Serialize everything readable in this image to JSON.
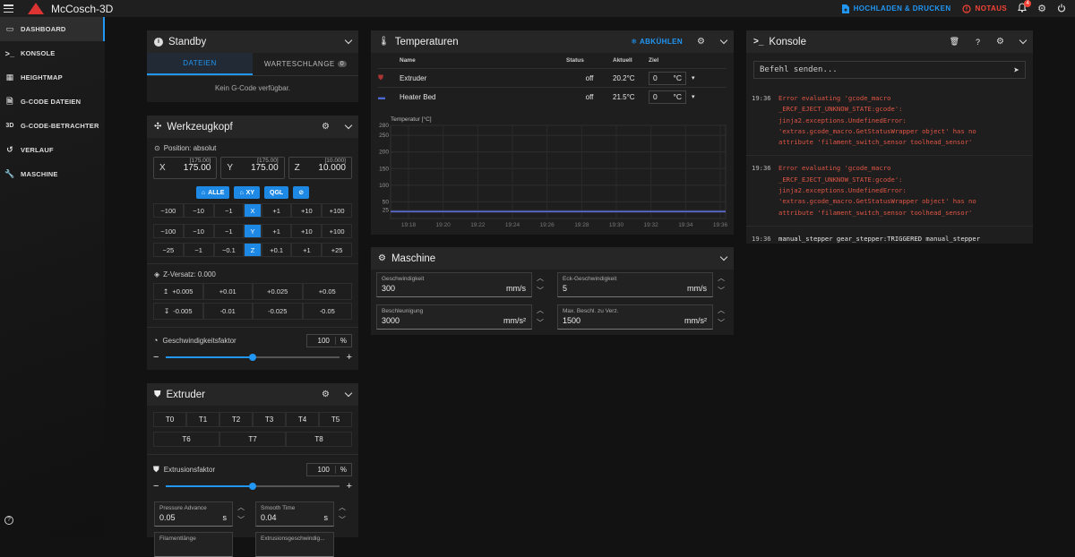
{
  "app": {
    "title": "McCosch-3D"
  },
  "topbar": {
    "upload_label": "HOCHLADEN & DRUCKEN",
    "estop_label": "NOTAUS",
    "notif_count": "4"
  },
  "nav": [
    {
      "label": "DASHBOARD",
      "icon": "dashboard-icon",
      "active": true
    },
    {
      "label": "KONSOLE",
      "icon": "console-icon"
    },
    {
      "label": "HEIGHTMAP",
      "icon": "grid-icon"
    },
    {
      "label": "G-CODE DATEIEN",
      "icon": "file-icon"
    },
    {
      "label": "G-CODE-BETRACHTER",
      "icon": "3d-icon"
    },
    {
      "label": "VERLAUF",
      "icon": "history-icon"
    },
    {
      "label": "MASCHINE",
      "icon": "wrench-icon"
    }
  ],
  "standby": {
    "title": "Standby",
    "tab_files": "DATEIEN",
    "tab_queue": "WARTESCHLANGE",
    "queue_count": "0",
    "empty": "Kein G-Code verfügbar."
  },
  "toolhead": {
    "title": "Werkzeugkopf",
    "position_label": "Position: absolut",
    "x": {
      "axis": "X",
      "value": "175.00",
      "max": "[175.00]"
    },
    "y": {
      "axis": "Y",
      "value": "175.00",
      "max": "[175.00]"
    },
    "z": {
      "axis": "Z",
      "value": "10.000",
      "max": "[10.000]"
    },
    "home_all": "ALLE",
    "home_xy": "XY",
    "qgl": "QGL",
    "jog_x": [
      "−100",
      "−10",
      "−1",
      "X",
      "+1",
      "+10",
      "+100"
    ],
    "jog_y": [
      "−100",
      "−10",
      "−1",
      "Y",
      "+1",
      "+10",
      "+100"
    ],
    "jog_z": [
      "−25",
      "−1",
      "−0.1",
      "Z",
      "+0.1",
      "+1",
      "+25"
    ],
    "zoffset_label": "Z-Versatz: 0.000",
    "zoff_up": [
      "+0.005",
      "+0.01",
      "+0.025",
      "+0.05"
    ],
    "zoff_down": [
      "-0.005",
      "-0.01",
      "-0.025",
      "-0.05"
    ],
    "speed_label": "Geschwindigkeitsfaktor",
    "speed_value": "100",
    "speed_unit": "%",
    "speed_fraction": 0.5
  },
  "extruder": {
    "title": "Extruder",
    "tools_row1": [
      "T0",
      "T1",
      "T2",
      "T3",
      "T4",
      "T5"
    ],
    "tools_row2": [
      "T6",
      "T7",
      "T8"
    ],
    "factor_label": "Extrusionsfaktor",
    "factor_value": "100",
    "factor_unit": "%",
    "factor_fraction": 0.5,
    "pa_label": "Pressure Advance",
    "pa_value": "0.05",
    "pa_unit": "s",
    "st_label": "Smooth Time",
    "st_value": "0.04",
    "st_unit": "s",
    "len_label": "Filamentlänge",
    "speed_label": "Extrusionsgeschwindig..."
  },
  "temps": {
    "title": "Temperaturen",
    "cooldown": "ABKÜHLEN",
    "headers": {
      "name": "Name",
      "status": "Status",
      "actual": "Aktuell",
      "target": "Ziel"
    },
    "rows": [
      {
        "name": "Extruder",
        "status": "off",
        "actual": "20.2°C",
        "target": "0",
        "unit": "°C"
      },
      {
        "name": "Heater Bed",
        "status": "off",
        "actual": "21.5°C",
        "target": "0",
        "unit": "°C"
      }
    ],
    "chart_ylabel": "Temperatur [°C]"
  },
  "chart_data": {
    "type": "line",
    "ylabel": "Temperatur [°C]",
    "ylim": [
      0,
      280
    ],
    "yticks": [
      25,
      50,
      100,
      150,
      200,
      250,
      280
    ],
    "xticks": [
      "19:18",
      "19:20",
      "19:22",
      "19:24",
      "19:26",
      "19:28",
      "19:30",
      "19:32",
      "19:34",
      "19:36"
    ],
    "series": [
      {
        "name": "Extruder",
        "values": [
          20.2,
          20.2,
          20.2,
          20.2,
          20.2,
          20.2,
          20.2,
          20.2,
          20.2,
          20.2
        ],
        "color": "#8a6bd9"
      },
      {
        "name": "Heater Bed",
        "values": [
          21.5,
          21.5,
          21.5,
          21.5,
          21.5,
          21.5,
          21.5,
          21.5,
          21.5,
          21.5
        ],
        "color": "#4a6ad0"
      }
    ]
  },
  "machine": {
    "title": "Maschine",
    "speed_label": "Geschwindigkeit",
    "speed_value": "300",
    "speed_unit": "mm/s",
    "scv_label": "Eck-Geschwindigkeit",
    "scv_value": "5",
    "scv_unit": "mm/s",
    "accel_label": "Beschleunigung",
    "accel_value": "3000",
    "accel_unit": "mm/s²",
    "decel_label": "Max. Beschl. zu Verz.",
    "decel_value": "1500",
    "decel_unit": "mm/s²"
  },
  "console": {
    "title": "Konsole",
    "placeholder": "Befehl senden...",
    "entries": [
      {
        "time": "19:36",
        "type": "err",
        "text": "Error evaluating 'gcode_macro\n_ERCF_EJECT_UNKNOW_STATE:gcode':\njinja2.exceptions.UndefinedError:\n'extras.gcode_macro.GetStatusWrapper object' has no\nattribute 'filament_switch_sensor toolhead_sensor'"
      },
      {
        "time": "19:36",
        "type": "err",
        "text": "Error evaluating 'gcode_macro\n_ERCF_EJECT_UNKNOW_STATE:gcode':\njinja2.exceptions.UndefinedError:\n'extras.gcode_macro.GetStatusWrapper object' has no\nattribute 'filament_switch_sensor toolhead_sensor'"
      },
      {
        "time": "19:36",
        "type": "info",
        "text": "manual_stepper gear_stepper:TRIGGERED manual_stepper\nselector_stepper:TRIGGERED x:open y:open z:open"
      }
    ]
  }
}
